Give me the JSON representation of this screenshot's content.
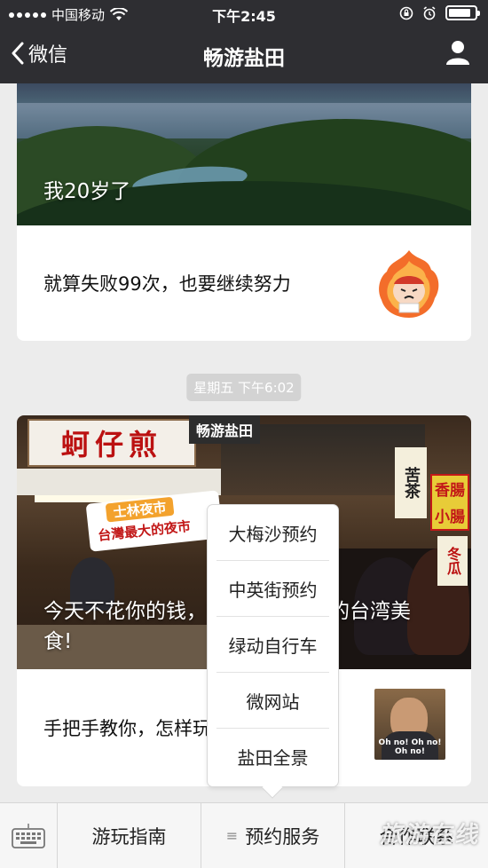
{
  "status_bar": {
    "carrier": "中国移动",
    "time": "下午2:45"
  },
  "nav": {
    "back_label": "微信",
    "title": "畅游盐田"
  },
  "messages": [
    {
      "hero_title": "我20岁了",
      "subtitle": "就算失败99次，也要继续努力"
    },
    {
      "timestamp": "星期五 下午6:02",
      "hero_title": "今天不花你的钱，带你吃遍地道的台湾美食!",
      "subtitle": "手把手教你，怎样玩转台湾夜市",
      "image_text": {
        "sign_main": "蚵仔煎",
        "brand_tag": "畅游盐田",
        "banner_line1": "士林夜市",
        "banner_line2": "台灣最大的夜市",
        "sign_right1": "苦茶",
        "sign_right2": "香腸小腸",
        "sign_right3": "冬瓜",
        "thumb_caption": "Oh no! Oh no! Oh no!"
      }
    }
  ],
  "popup_menu": {
    "items": [
      "大梅沙预约",
      "中英街预约",
      "绿动自行车",
      "微网站",
      "盐田全景"
    ]
  },
  "bottom_menu": {
    "tabs": [
      "游玩指南",
      "预约服务",
      "合作联系"
    ]
  },
  "watermark": "旅游在线",
  "colors": {
    "nav_bg": "#2e2e32",
    "page_bg": "#ececec",
    "card_bg": "#ffffff",
    "timestamp_bg": "#d3d3d3"
  },
  "icons": {
    "back": "chevron-left-icon",
    "profile": "person-icon",
    "keyboard": "keyboard-icon",
    "menu_lines": "hamburger-icon"
  }
}
